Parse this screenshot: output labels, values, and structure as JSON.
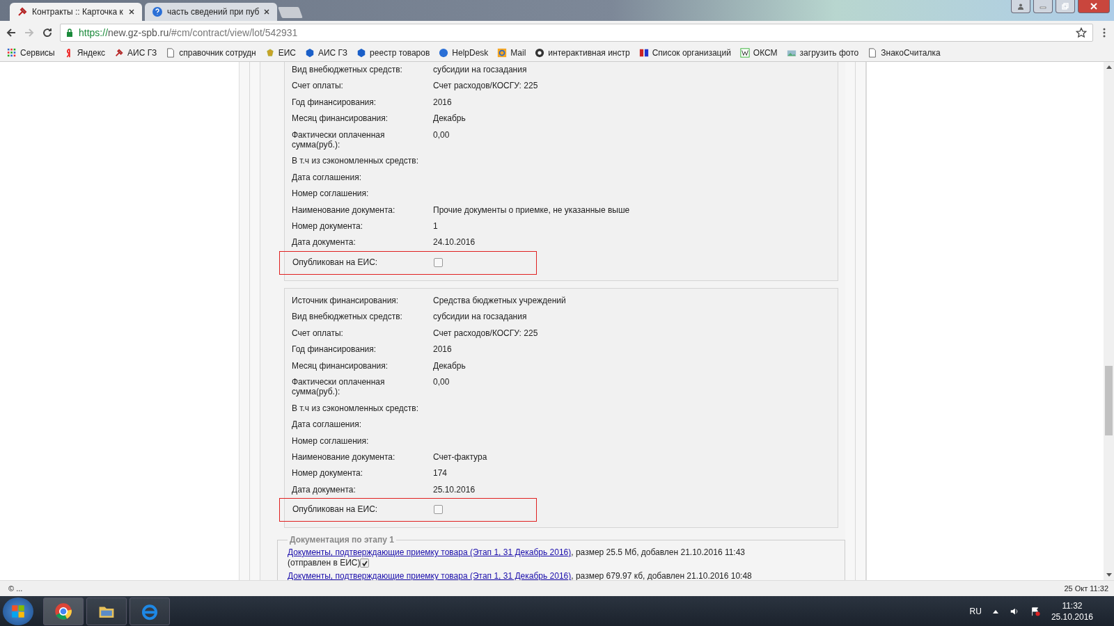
{
  "browser": {
    "tabs": [
      {
        "title": "Контракты :: Карточка к",
        "selected": true
      },
      {
        "title": "часть сведений при пуб",
        "selected": false
      }
    ],
    "url": {
      "scheme": "https://",
      "host": "new.gz-spb.ru",
      "path": "/#cm/contract/view/lot/542931"
    },
    "bookmarks": [
      {
        "label": "Сервисы"
      },
      {
        "label": "Яндекс"
      },
      {
        "label": "АИС ГЗ"
      },
      {
        "label": "справочник сотрудн"
      },
      {
        "label": "ЕИС"
      },
      {
        "label": "АИС ГЗ"
      },
      {
        "label": "реестр товаров"
      },
      {
        "label": "HelpDesk"
      },
      {
        "label": "Mail"
      },
      {
        "label": "интерактивная инстр"
      },
      {
        "label": "Список организаций"
      },
      {
        "label": "ОКСМ"
      },
      {
        "label": "загрузить фото"
      },
      {
        "label": "ЗнакоСчиталка"
      }
    ]
  },
  "funding_blocks": [
    {
      "fields": [
        {
          "label": "Вид внебюджетных средств:",
          "value": "субсидии на госзадания"
        },
        {
          "label": "Счет оплаты:",
          "value": "Счет расходов/КОСГУ: 225"
        },
        {
          "label": "Год финансирования:",
          "value": "2016"
        },
        {
          "label": "Месяц финансирования:",
          "value": "Декабрь"
        },
        {
          "label": "Фактически оплаченная сумма(руб.):",
          "value": "0,00"
        },
        {
          "label": "В т.ч из сэкономленных средств:"
        },
        {
          "label": "Дата соглашения:"
        },
        {
          "label": "Номер соглашения:"
        },
        {
          "label": "Наименование документа:",
          "value": "Прочие документы о приемке, не указанные выше"
        },
        {
          "label": "Номер документа:",
          "value": "1"
        },
        {
          "label": "Дата документа:",
          "value": "24.10.2016"
        }
      ],
      "published": {
        "label": "Опубликован на ЕИС:",
        "checked": false,
        "highlighted": true
      }
    },
    {
      "fields": [
        {
          "label": "Источник финансирования:",
          "value": "Средства бюджетных учреждений"
        },
        {
          "label": "Вид внебюджетных средств:",
          "value": "субсидии на госзадания"
        },
        {
          "label": "Счет оплаты:",
          "value": "Счет расходов/КОСГУ: 225"
        },
        {
          "label": "Год финансирования:",
          "value": "2016"
        },
        {
          "label": "Месяц финансирования:",
          "value": "Декабрь"
        },
        {
          "label": "Фактически оплаченная сумма(руб.):",
          "value": "0,00"
        },
        {
          "label": "В т.ч из сэкономленных средств:"
        },
        {
          "label": "Дата соглашения:"
        },
        {
          "label": "Номер соглашения:"
        },
        {
          "label": "Наименование документа:",
          "value": "Счет-фактура"
        },
        {
          "label": "Номер документа:",
          "value": "174"
        },
        {
          "label": "Дата документа:",
          "value": "25.10.2016"
        }
      ],
      "published": {
        "label": "Опубликован на ЕИС:",
        "checked": false,
        "highlighted": true
      }
    }
  ],
  "documents": {
    "legend": "Документация по этапу 1",
    "items": [
      {
        "link": "Документы, подтверждающие приемку товара (Этап 1, 31 Декабрь 2016)",
        "details": ", размер 25.5 Мб, добавлен 21.10.2016 11:43",
        "sent_label": "(отправлен в ЕИС)",
        "sent_checked": true
      },
      {
        "link": "Документы, подтверждающие приемку товара (Этап 1, 31 Декабрь 2016)",
        "details": ", размер 679.97 кб, добавлен 21.10.2016 10:48"
      }
    ]
  },
  "status_bar": {
    "left": "© ...",
    "right": "25 Окт 11:32"
  },
  "taskbar": {
    "language": "RU",
    "time": "11:32",
    "date": "25.10.2016"
  }
}
